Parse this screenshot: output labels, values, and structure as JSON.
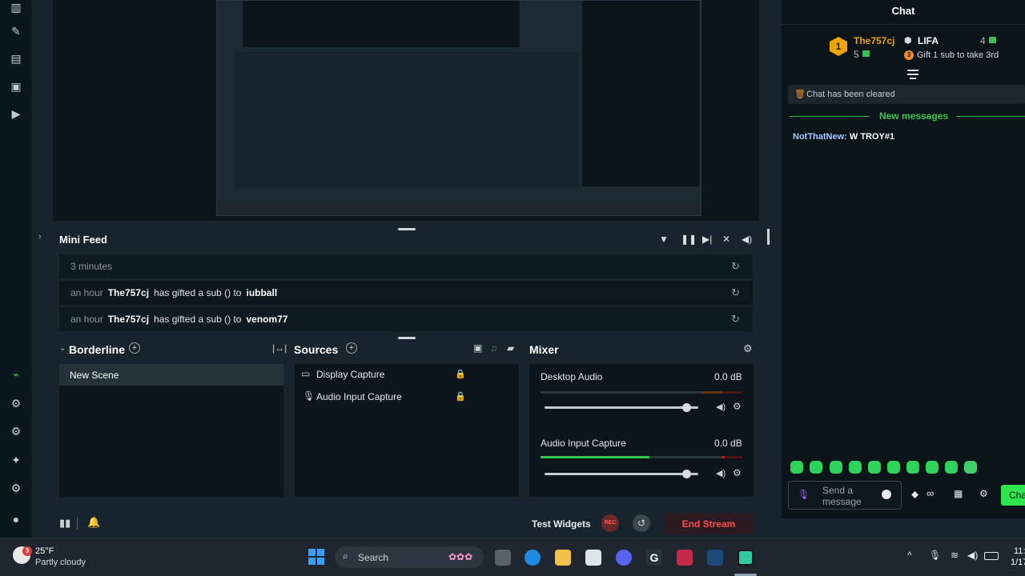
{
  "mini_feed": {
    "title": "Mini Feed",
    "rows": [
      {
        "time": "3 minutes"
      },
      {
        "time": "an hour",
        "user": "The757cj",
        "text": "has gifted a sub () to",
        "target": "iubball"
      },
      {
        "time": "an hour",
        "user": "The757cj",
        "text": "has gifted a sub () to",
        "target": "venom77"
      }
    ]
  },
  "scenes": {
    "title": "Borderline",
    "items": [
      "New Scene"
    ]
  },
  "sources": {
    "title": "Sources",
    "items": [
      "Display Capture",
      "Audio Input Capture"
    ]
  },
  "mixer": {
    "title": "Mixer",
    "channels": [
      {
        "name": "Desktop Audio",
        "db": "0.0 dB",
        "level": 0.92
      },
      {
        "name": "Audio Input Capture",
        "db": "0.0 dB",
        "level": 0.92
      }
    ]
  },
  "bottom": {
    "test_widgets": "Test Widgets",
    "rec": "REC",
    "end_stream": "End Stream"
  },
  "chat": {
    "title": "Chat",
    "leader": {
      "rank": "1",
      "name": "The757cj",
      "count": "5"
    },
    "second": {
      "name": "LIFA",
      "count": "4",
      "hint": "Gift 1 sub to take 3rd"
    },
    "cleared": "Chat has been cleared",
    "new_messages": "New messages",
    "message": {
      "user": "NotThatNew:",
      "text": " W TROY#1"
    },
    "input_placeholder_1": "Send a",
    "input_placeholder_2": "message",
    "chat_btn": "Cha"
  },
  "taskbar": {
    "weather_temp": "25°F",
    "weather_desc": "Partly cloudy",
    "weather_badge": "3",
    "search": "Search",
    "clock_time": "11:",
    "clock_date": "1/17"
  },
  "colors": {
    "accent": "#31c74f",
    "end_stream": "#ff4040",
    "gold": "#f0a500",
    "mention": "#a6c9ff"
  }
}
